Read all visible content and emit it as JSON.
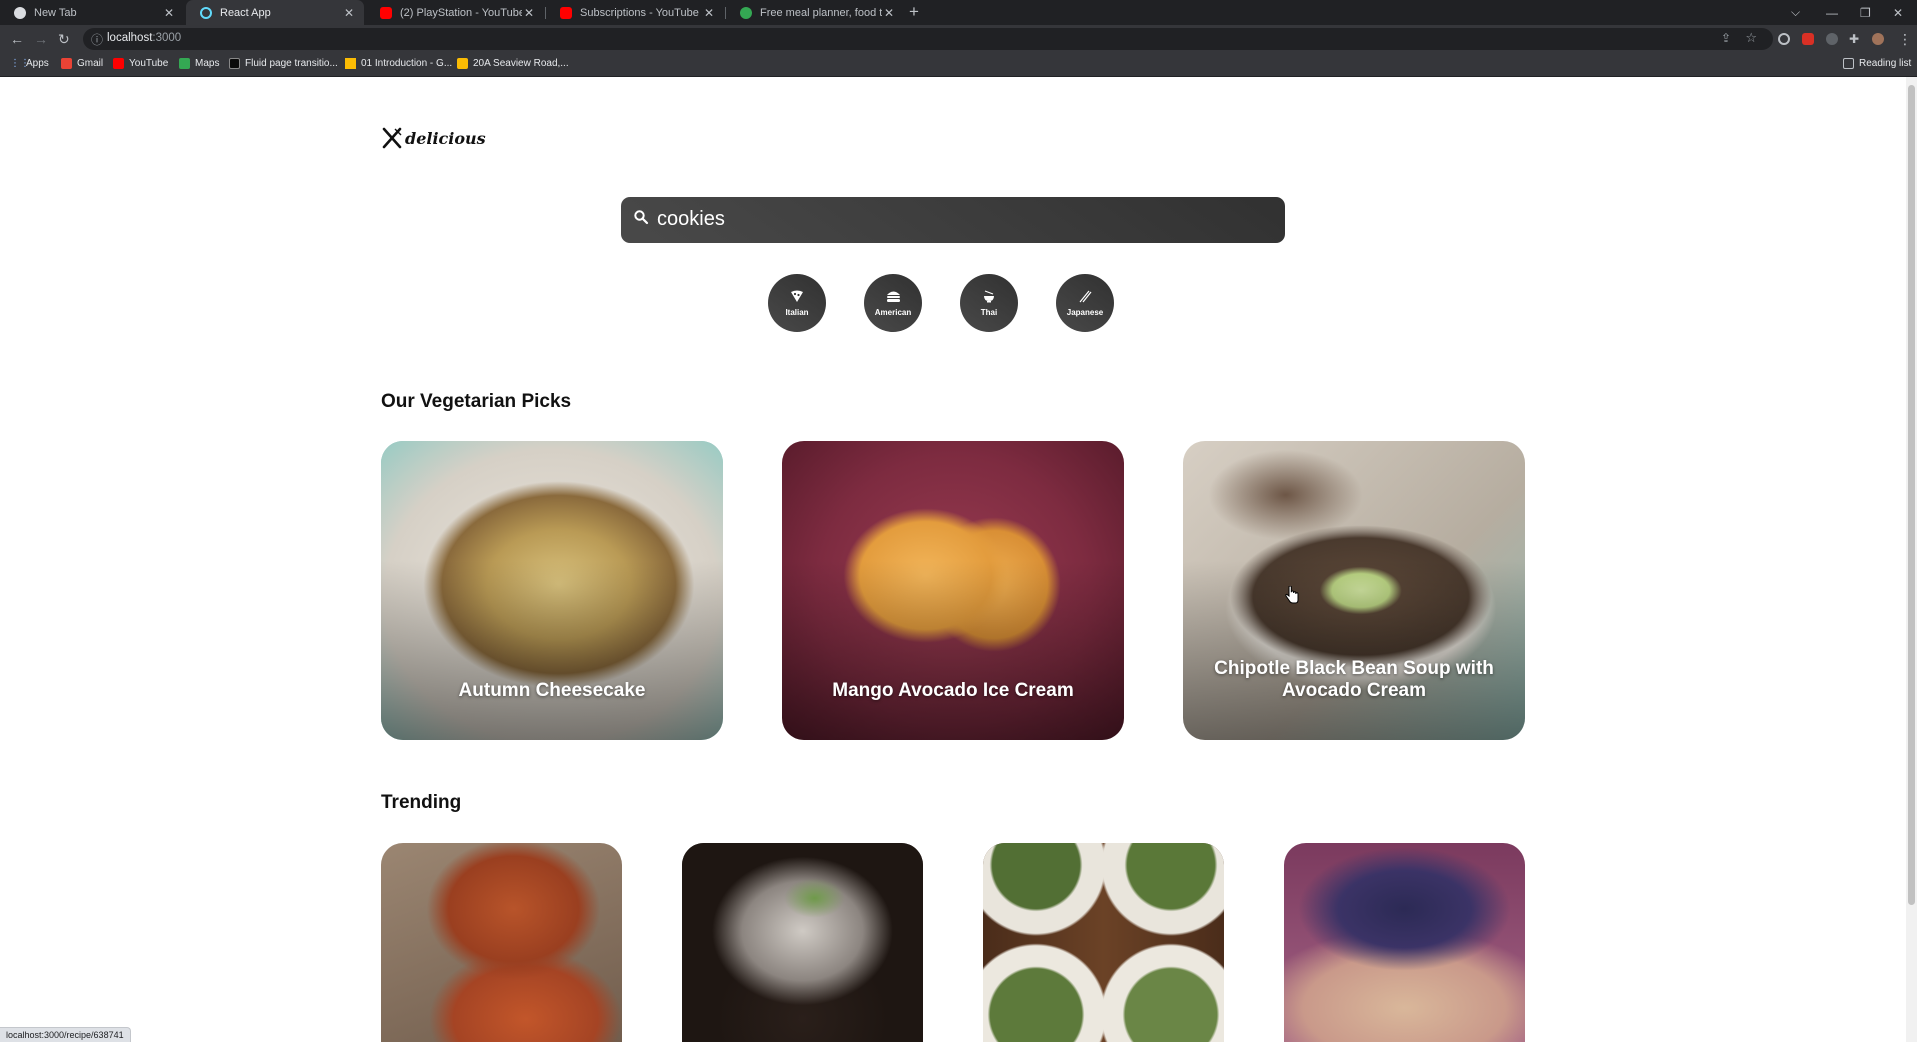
{
  "browser": {
    "tabs": [
      {
        "title": "New Tab",
        "active": false
      },
      {
        "title": "React App",
        "active": true
      },
      {
        "title": "(2) PlayStation - YouTube",
        "active": false
      },
      {
        "title": "Subscriptions - YouTube",
        "active": false
      },
      {
        "title": "Free meal planner, food tracker,...",
        "active": false
      }
    ],
    "url_host": "localhost",
    "url_port": ":3000",
    "bookmarks": [
      {
        "label": "Apps",
        "icon": "apps-grid-icon",
        "color": "#8ab4f8"
      },
      {
        "label": "Gmail",
        "icon": "gmail-icon",
        "color": "#ea4335"
      },
      {
        "label": "YouTube",
        "icon": "youtube-icon",
        "color": "#ff0000"
      },
      {
        "label": "Maps",
        "icon": "maps-icon",
        "color": "#34a853"
      },
      {
        "label": "Fluid page transitio...",
        "icon": "dev-icon",
        "color": "#0a0a0a"
      },
      {
        "label": "01 Introduction - G...",
        "icon": "drive-icon",
        "color": "#fbbc04"
      },
      {
        "label": "20A Seaview Road,...",
        "icon": "google-maps-icon",
        "color": "#fbbc04"
      }
    ],
    "reading_list": "Reading list",
    "status_url": "localhost:3000/recipe/638741"
  },
  "app": {
    "logo_text": "delicious",
    "search": {
      "value": "cookies"
    },
    "cuisines": [
      {
        "label": "Italian",
        "icon": "pizza-icon"
      },
      {
        "label": "American",
        "icon": "hamburger-icon"
      },
      {
        "label": "Thai",
        "icon": "noodles-bowl-icon"
      },
      {
        "label": "Japanese",
        "icon": "chopsticks-icon"
      }
    ],
    "veggie_title": "Our Vegetarian Picks",
    "veggie": [
      {
        "title": "Autumn Cheesecake"
      },
      {
        "title": "Mango Avocado Ice Cream"
      },
      {
        "title": "Chipotle Black Bean Soup with Avocado Cream"
      }
    ],
    "trending_title": "Trending",
    "trending": [
      {
        "title": ""
      },
      {
        "title": ""
      },
      {
        "title": ""
      },
      {
        "title": ""
      }
    ]
  }
}
